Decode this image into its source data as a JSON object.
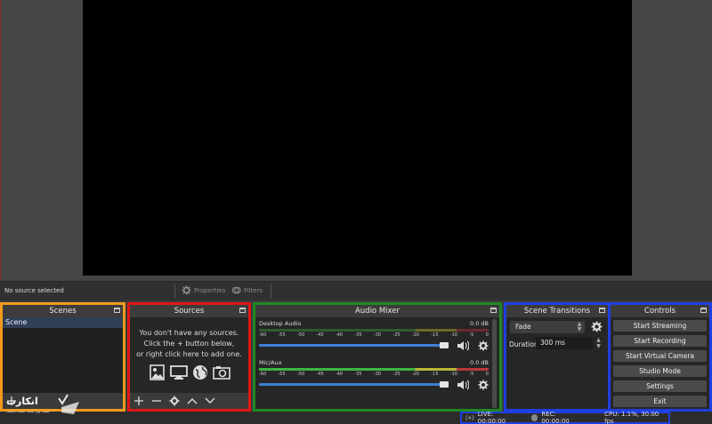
{
  "preview": {},
  "source_bar": {
    "no_source": "No source selected",
    "properties_label": "Properties",
    "filters_label": "Filters"
  },
  "scenes": {
    "title": "Scenes",
    "items": [
      "Scene"
    ]
  },
  "sources": {
    "title": "Sources",
    "empty_line1": "You don't have any sources.",
    "empty_line2": "Click the + button below,",
    "empty_line3": "or right click here to add one."
  },
  "mixer": {
    "title": "Audio Mixer",
    "ticks": [
      "-60",
      "-55",
      "-50",
      "-45",
      "-40",
      "-35",
      "-30",
      "-25",
      "-20",
      "-15",
      "-10",
      "-5",
      "0"
    ],
    "channels": [
      {
        "name": "Desktop Audio",
        "db": "0.0 dB",
        "level": 1.0
      },
      {
        "name": "Mic/Aux",
        "db": "0.0 dB",
        "level": 1.0
      }
    ]
  },
  "transitions": {
    "title": "Scene Transitions",
    "selected": "Fade",
    "duration_label": "Duration",
    "duration_value": "300 ms"
  },
  "controls": {
    "title": "Controls",
    "buttons": [
      "Start Streaming",
      "Start Recording",
      "Start Virtual Camera",
      "Studio Mode",
      "Settings",
      "Exit"
    ]
  },
  "status": {
    "live": "LIVE: 00:00:00",
    "rec": "REC: 00:00:00",
    "cpu": "CPU: 1.1%, 30.00 fps"
  },
  "watermark": {
    "text": "انکارت",
    "subtext": "امنیت وپل شما، امنیت ماست"
  },
  "colors": {
    "scenes_highlight": "#f39a1e",
    "sources_highlight": "#e01616",
    "mixer_highlight": "#1e8a23",
    "controls_highlight": "#1f3fe0",
    "fader": "#3d7fd6"
  }
}
